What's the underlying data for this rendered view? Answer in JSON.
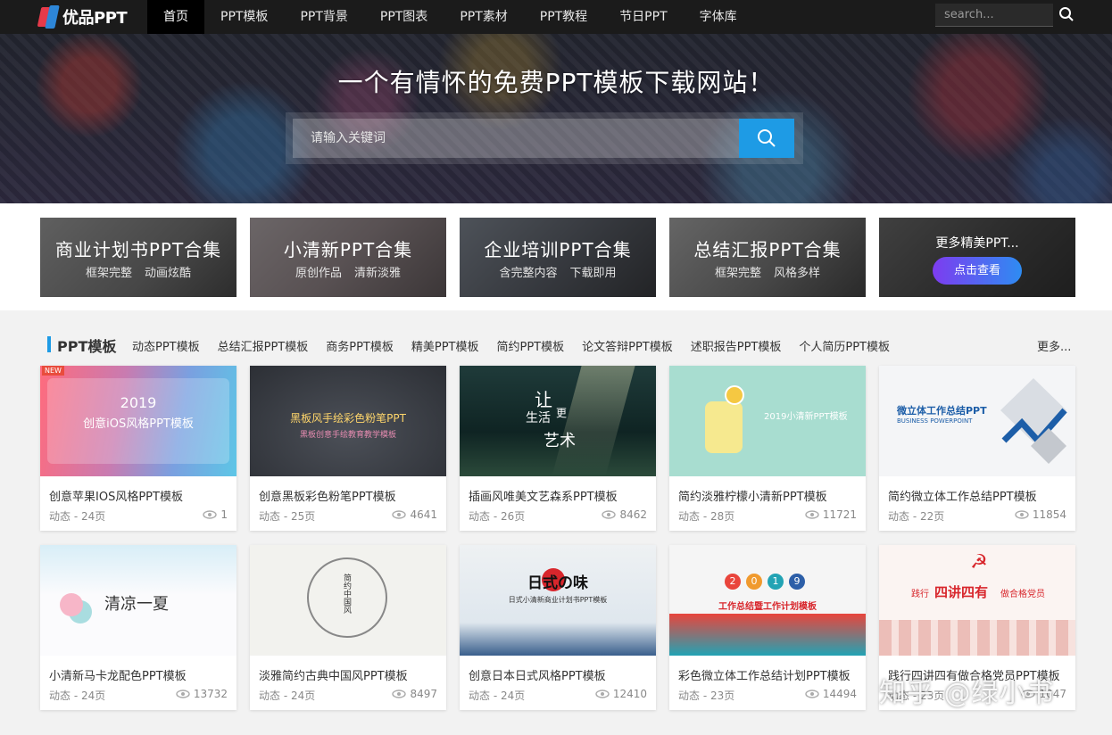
{
  "nav": {
    "logo": "优品PPT",
    "items": [
      "首页",
      "PPT模板",
      "PPT背景",
      "PPT图表",
      "PPT素材",
      "PPT教程",
      "节日PPT",
      "字体库"
    ],
    "search_placeholder": "search..."
  },
  "hero": {
    "title": "一个有情怀的免费PPT模板下载网站！",
    "search_placeholder": "请输入关键词"
  },
  "collections": [
    {
      "title": "商业计划书PPT合集",
      "tags": [
        "框架完整",
        "动画炫酷"
      ]
    },
    {
      "title": "小清新PPT合集",
      "tags": [
        "原创作品",
        "清新淡雅"
      ]
    },
    {
      "title": "企业培训PPT合集",
      "tags": [
        "含完整内容",
        "下载即用"
      ]
    },
    {
      "title": "总结汇报PPT合集",
      "tags": [
        "框架完整",
        "风格多样"
      ]
    }
  ],
  "more_collection": {
    "title": "更多精美PPT...",
    "button": "点击查看"
  },
  "section": {
    "title": "PPT模板",
    "tags": [
      "动态PPT模板",
      "总结汇报PPT模板",
      "商务PPT模板",
      "精美PPT模板",
      "简约PPT模板",
      "论文答辩PPT模板",
      "述职报告PPT模板",
      "个人简历PPT模板"
    ],
    "more": "更多..."
  },
  "cards": [
    {
      "title": "创意苹果IOS风格PPT模板",
      "meta": "动态 - 24页",
      "views": "1",
      "badge": "NEW",
      "thumb_lines": [
        "2019",
        "创意iOS风格PPT模板"
      ]
    },
    {
      "title": "创意黑板彩色粉笔PPT模板",
      "meta": "动态 - 25页",
      "views": "4641",
      "thumb_lines": [
        "黑板风手绘彩色粉笔PPT",
        "黑板创意手绘教育教学模板"
      ]
    },
    {
      "title": "插画风唯美文艺森系PPT模板",
      "meta": "动态 - 26页",
      "views": "8462",
      "thumb_lines": [
        "让",
        "生活",
        "更",
        "艺术"
      ]
    },
    {
      "title": "简约淡雅柠檬小清新PPT模板",
      "meta": "动态 - 28页",
      "views": "11721",
      "thumb_lines": [
        "2019小清新PPT模板"
      ]
    },
    {
      "title": "简约微立体工作总结PPT模板",
      "meta": "动态 - 22页",
      "views": "11854",
      "thumb_lines": [
        "微立体工作总结PPT",
        "BUSINESS POWERPOINT"
      ]
    },
    {
      "title": "小清新马卡龙配色PPT模板",
      "meta": "动态 - 24页",
      "views": "13732",
      "thumb_lines": [
        "清凉一夏"
      ]
    },
    {
      "title": "淡雅简约古典中国风PPT模板",
      "meta": "动态 - 24页",
      "views": "8497",
      "thumb_lines": [
        "简约中国风"
      ]
    },
    {
      "title": "创意日本日式风格PPT模板",
      "meta": "动态 - 24页",
      "views": "12410",
      "thumb_lines": [
        "日式の味",
        "日式小清新商业计划书PPT模板"
      ]
    },
    {
      "title": "彩色微立体工作总结计划PPT模板",
      "meta": "动态 - 23页",
      "views": "14494",
      "thumb_lines": [
        "2",
        "0",
        "1",
        "9",
        "工作总结暨工作计划模板"
      ]
    },
    {
      "title": "践行四讲四有做合格党员PPT模板",
      "meta": "动态 - 23页",
      "views": "1047",
      "thumb_lines": [
        "践行",
        "四讲四有",
        "做合格党员"
      ]
    }
  ],
  "watermark": "知乎 @绿小书"
}
